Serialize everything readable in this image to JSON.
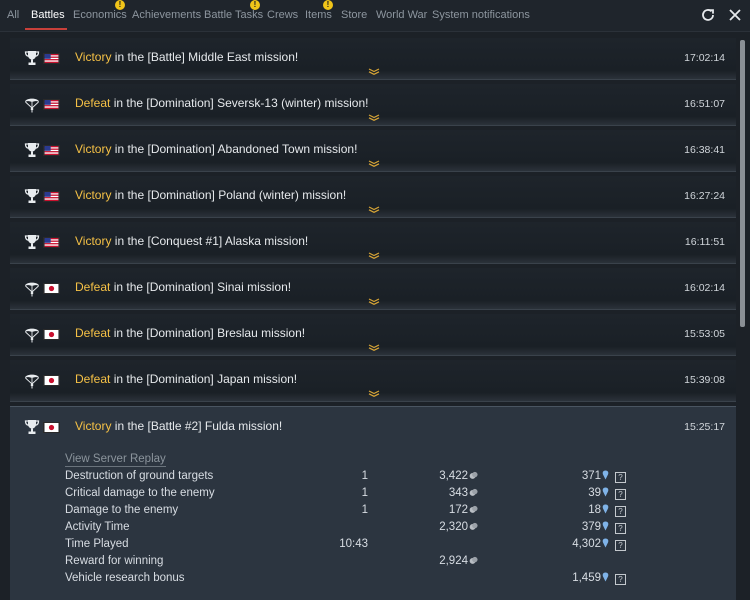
{
  "tabs": [
    {
      "label": "All",
      "active": false,
      "badge": ""
    },
    {
      "label": "Battles",
      "active": true,
      "badge": ""
    },
    {
      "label": "Economics",
      "active": false,
      "badge": "!"
    },
    {
      "label": "Achievements",
      "active": false,
      "badge": ""
    },
    {
      "label": "Battle Tasks",
      "active": false,
      "badge": "!"
    },
    {
      "label": "Crews",
      "active": false,
      "badge": ""
    },
    {
      "label": "Items",
      "active": false,
      "badge": "!"
    },
    {
      "label": "Store",
      "active": false,
      "badge": ""
    },
    {
      "label": "World War",
      "active": false,
      "badge": ""
    },
    {
      "label": "System notifications",
      "active": false,
      "badge": ""
    }
  ],
  "entries": [
    {
      "result": "Victory",
      "text": " in the [Battle] Middle East mission!",
      "time": "17:02:14",
      "icon": "trophy-icon",
      "nation": "usa"
    },
    {
      "result": "Defeat",
      "text": " in the [Domination] Seversk-13 (winter) mission!",
      "time": "16:51:07",
      "icon": "parachute-icon",
      "nation": "usa"
    },
    {
      "result": "Victory",
      "text": " in the [Domination] Abandoned Town mission!",
      "time": "16:38:41",
      "icon": "trophy-icon",
      "nation": "usa"
    },
    {
      "result": "Victory",
      "text": " in the [Domination] Poland (winter) mission!",
      "time": "16:27:24",
      "icon": "trophy-icon",
      "nation": "usa"
    },
    {
      "result": "Victory",
      "text": " in the [Conquest #1] Alaska mission!",
      "time": "16:11:51",
      "icon": "trophy-icon",
      "nation": "usa"
    },
    {
      "result": "Defeat",
      "text": " in the [Domination] Sinai mission!",
      "time": "16:02:14",
      "icon": "parachute-icon",
      "nation": "japan"
    },
    {
      "result": "Defeat",
      "text": " in the [Domination] Breslau mission!",
      "time": "15:53:05",
      "icon": "parachute-icon",
      "nation": "japan"
    },
    {
      "result": "Defeat",
      "text": " in the [Domination] Japan mission!",
      "time": "15:39:08",
      "icon": "parachute-icon",
      "nation": "japan"
    }
  ],
  "expanded": {
    "result": "Victory",
    "text": " in the [Battle #2] Fulda mission!",
    "time": "15:25:17",
    "icon": "trophy-icon",
    "nation": "japan",
    "replay_label": "View Server Replay",
    "rows": [
      {
        "label": "Destruction of ground targets",
        "count": "1",
        "silver": "3,422",
        "rp": "371",
        "help": "?"
      },
      {
        "label": "Critical damage to the enemy",
        "count": "1",
        "silver": "343",
        "rp": "39",
        "help": "?"
      },
      {
        "label": "Damage to the enemy",
        "count": "1",
        "silver": "172",
        "rp": "18",
        "help": "?"
      },
      {
        "label": "Activity Time",
        "count": "",
        "silver": "2,320",
        "rp": "379",
        "help": "?"
      },
      {
        "label": "Time Played",
        "count": "10:43",
        "silver": "",
        "rp": "4,302",
        "help": "?"
      },
      {
        "label": "Reward for winning",
        "count": "",
        "silver": "2,924",
        "rp": "",
        "help": ""
      },
      {
        "label": "Vehicle research bonus",
        "count": "",
        "silver": "",
        "rp": "1,459",
        "help": "?"
      }
    ]
  },
  "colors": {
    "result": "#f5c146",
    "accent": "#c8403a",
    "badge": "#f0c419",
    "rp": "#7fb3e8"
  }
}
